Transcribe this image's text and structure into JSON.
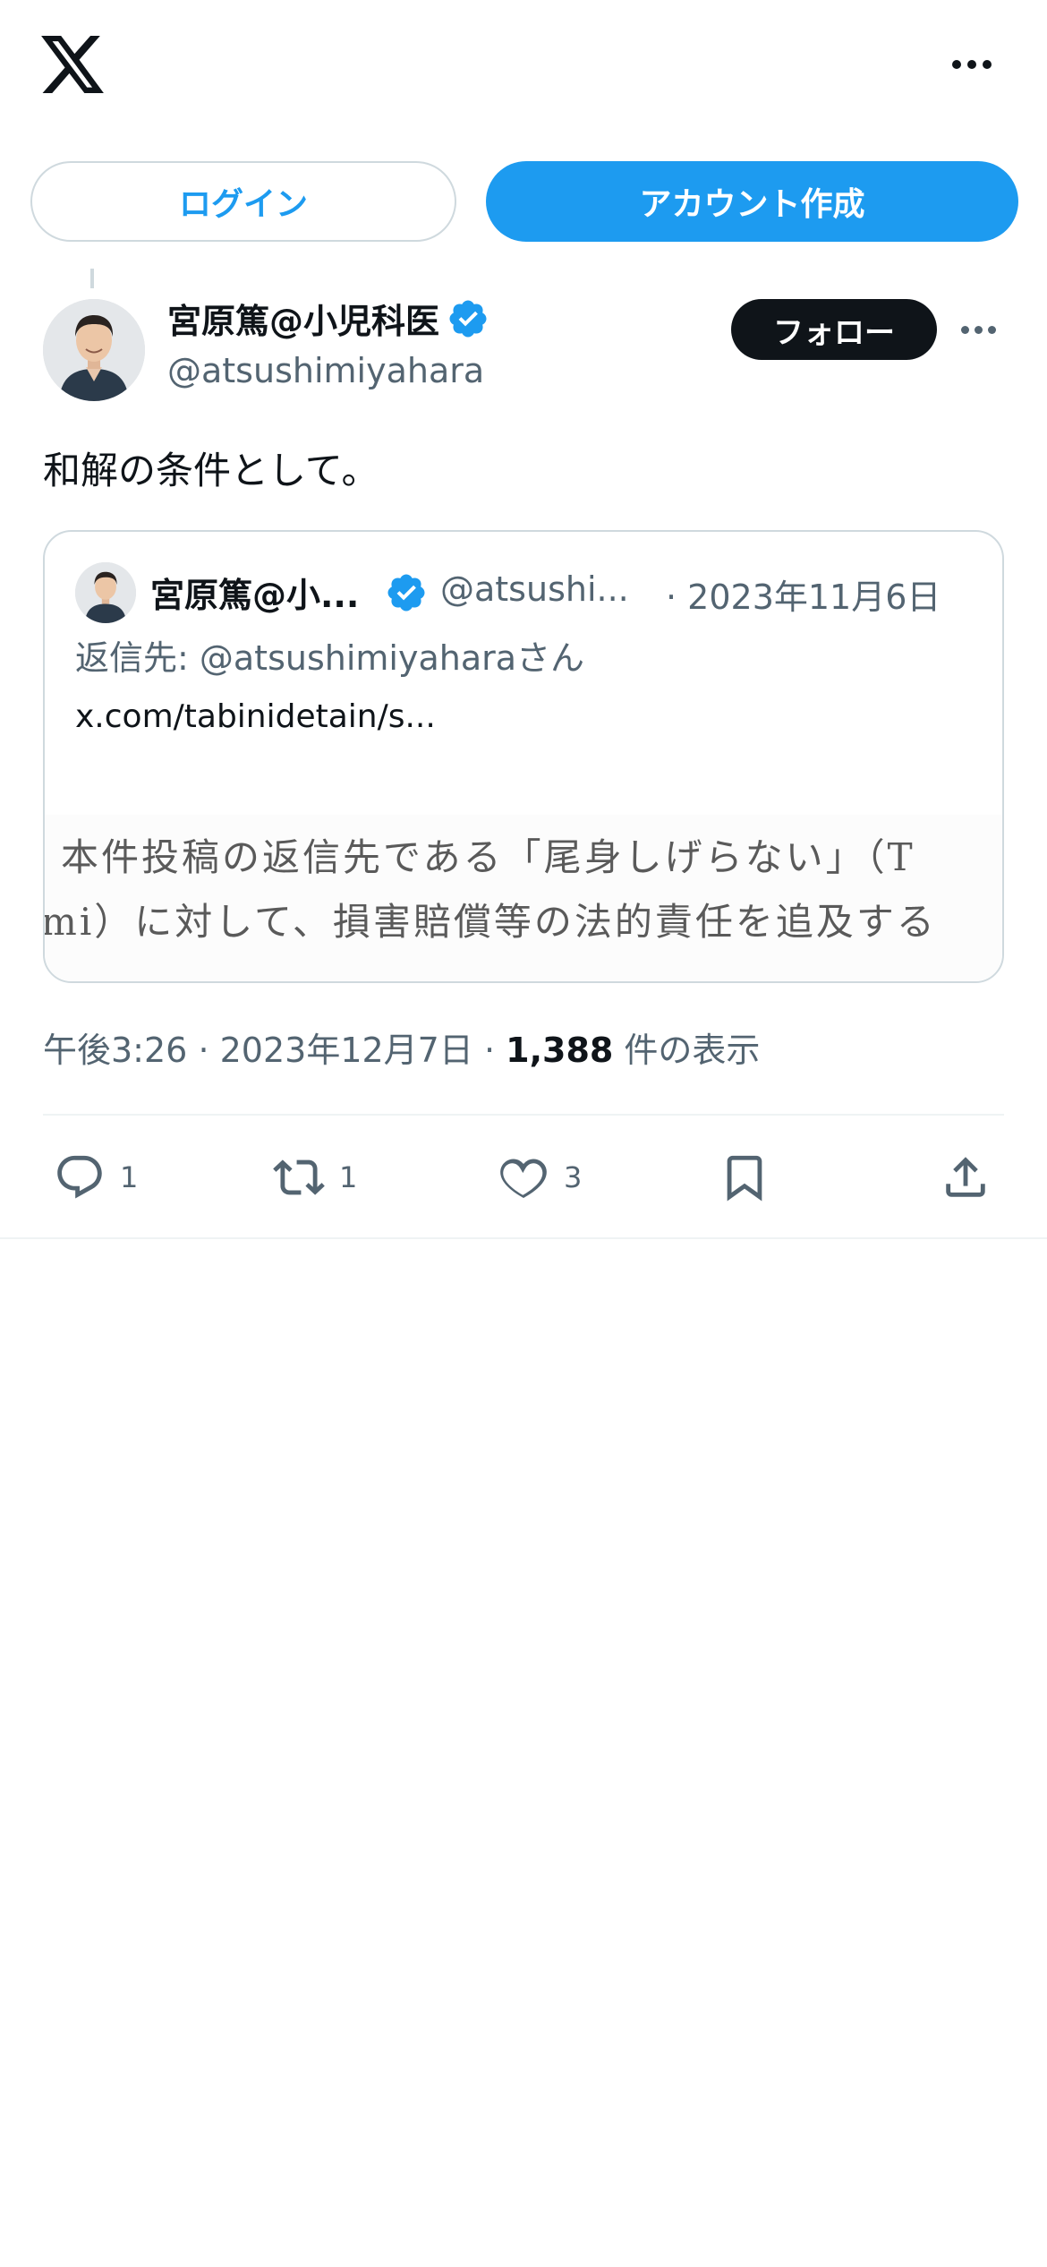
{
  "header": {
    "logo_icon": "x-logo-icon",
    "more_icon": "more-horizontal-icon"
  },
  "auth": {
    "login_label": "ログイン",
    "signup_label": "アカウント作成"
  },
  "tweet": {
    "author_name": "宮原篤@小児科医",
    "handle": "@atsushimiyahara",
    "follow_label": "フォロー",
    "text": "和解の条件として。",
    "quote": {
      "author_name": "宮原篤@小...",
      "handle": "@atsushi...",
      "date": "· 2023年11月6日",
      "reply_to": "返信先: @atsushimiyaharaさん",
      "link": "x.com/tabinidetain/s...",
      "image_line1": "本件投稿の返信先である「尾身しげらない」（T",
      "image_line2": "mi）に対して、損害賠償等の法的責任を追及する"
    },
    "meta": {
      "time": "午後3:26",
      "date": "2023年12月7日",
      "views": "1,388",
      "views_label": " 件の表示"
    },
    "actions": {
      "reply_count": "1",
      "retweet_count": "1",
      "like_count": "3"
    }
  },
  "colors": {
    "accent": "#1d9bf0",
    "text": "#0f1419",
    "secondary": "#536471",
    "border": "#cfd9de"
  }
}
